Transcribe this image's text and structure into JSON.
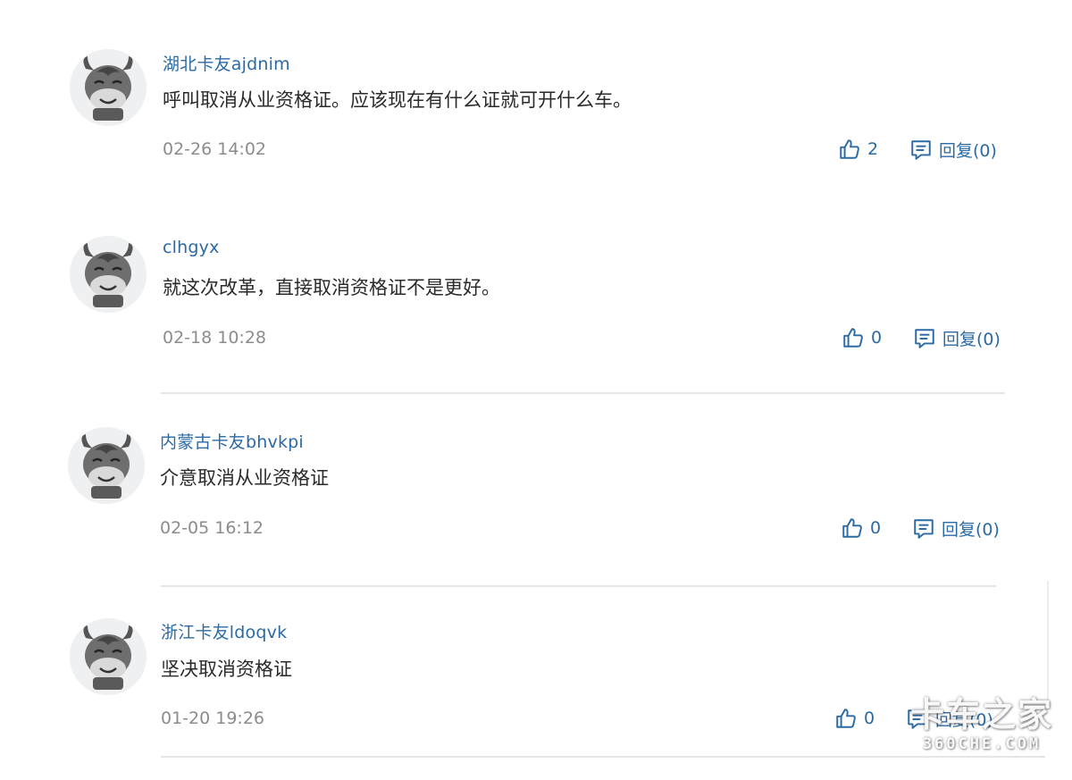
{
  "comments": [
    {
      "username": "湖北卡友ajdnim",
      "content": "呼叫取消从业资格证。应该现在有什么证就可开什么车。",
      "time": "02-26 14:02",
      "likes": "2",
      "reply_label": "回复(0)"
    },
    {
      "username": "clhgyx",
      "content": "就这次改革，直接取消资格证不是更好。",
      "time": "02-18 10:28",
      "likes": "0",
      "reply_label": "回复(0)"
    },
    {
      "username": "内蒙古卡友bhvkpi",
      "content": "介意取消从业资格证",
      "time": "02-05 16:12",
      "likes": "0",
      "reply_label": "回复(0)"
    },
    {
      "username": "浙江卡友ldoqvk",
      "content": "坚决取消资格证",
      "time": "01-20 19:26",
      "likes": "0",
      "reply_label": "回复(0)"
    }
  ],
  "watermark": {
    "main": "卡车之家",
    "sub": "360CHE.COM"
  },
  "colors": {
    "link": "#2b6aa3",
    "text": "#2a2a2a",
    "muted": "#8c8c8c",
    "divider": "#e6e6e6"
  },
  "icons": {
    "avatar": "cartoon-bull-avatar",
    "like": "thumbs-up-icon",
    "reply": "comment-icon"
  }
}
